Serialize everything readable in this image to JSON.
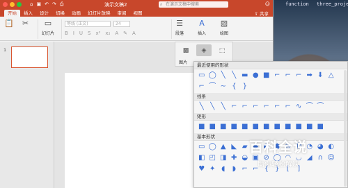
{
  "desktop": {
    "files": [
      "function",
      "three_project"
    ]
  },
  "titlebar": {
    "title": "演示文稿2",
    "search_placeholder": "在演示文稿中搜索",
    "share_label": "共享"
  },
  "tabs": [
    "开始",
    "插入",
    "设计",
    "切换",
    "动画",
    "幻灯片放映",
    "审阅",
    "视图"
  ],
  "ribbon": {
    "new_slide": "幻灯片",
    "font_placeholder": "等线 (正文)",
    "size_placeholder": "24",
    "paragraph": "段落",
    "insert": "插入",
    "draw": "绘图"
  },
  "slide_panel": {
    "number": "1"
  },
  "sub_toolbar": {
    "picture_label": "图片"
  },
  "shapes_panel": {
    "sections": [
      {
        "title": "最近使用的形状",
        "shapes": [
          "▭",
          "◯",
          "╲",
          "╲",
          "▬",
          "●",
          "■",
          "⌐",
          "⌐",
          "⌐",
          "➡",
          "⬇",
          "△",
          "⌐",
          "⌒",
          "∼",
          "{",
          "}"
        ]
      },
      {
        "title": "线条",
        "shapes": [
          "╲",
          "╲",
          "╲",
          "⌐",
          "⌐",
          "⌐",
          "⌐",
          "⌐",
          "⌐",
          "∿",
          "⌒",
          "⌒"
        ]
      },
      {
        "title": "矩形",
        "shapes": [
          "■",
          "■",
          "■",
          "■",
          "■",
          "■",
          "■",
          "■",
          "■",
          "■",
          "■",
          "■"
        ]
      },
      {
        "title": "基本形状",
        "shapes": [
          "▭",
          "◯",
          "▲",
          "◣",
          "▰",
          "◆",
          "⬢",
          "⬟",
          "⑩",
          "⑫",
          "◔",
          "◕",
          "◐",
          "◧",
          "◰",
          "◨",
          "✚",
          "◒",
          "▣",
          "⊘",
          "◯",
          "◠",
          "◡",
          "◢",
          "∩",
          "☺",
          "♥",
          "✦",
          "◖",
          "◗",
          "⌐",
          "⌐",
          "{",
          "}",
          "[",
          "]"
        ]
      }
    ]
  },
  "watermark": {
    "title": "百科全说",
    "subtitle": "助你轻松解决"
  },
  "colors": {
    "accent": "#c8472b",
    "shape_blue": "#3b6fd4"
  }
}
